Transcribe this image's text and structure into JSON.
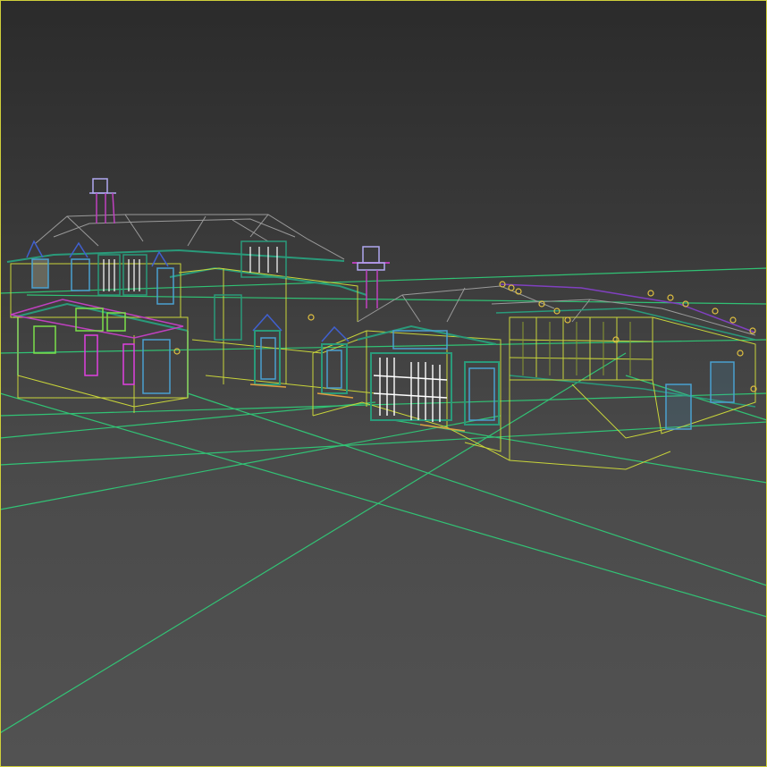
{
  "viewport": {
    "name": "3d-wireframe-viewport",
    "render_mode": "wireframe",
    "colors": {
      "background_top": "#2b2b2b",
      "background_bottom": "#525252",
      "ground_grid": "#2fd07a",
      "active_border": "#cfcf3a"
    }
  },
  "scene": {
    "objects": [
      {
        "name": "main-house-wireframe",
        "palette": [
          "#c8d43a",
          "#2a9a7a",
          "#e0e0e0",
          "#4aa0d0",
          "#c040c0"
        ]
      },
      {
        "name": "central-wing-wireframe",
        "palette": [
          "#c8d43a",
          "#2a9a7a",
          "#ffffff",
          "#4aa0d0"
        ]
      },
      {
        "name": "east-wing-wireframe",
        "palette": [
          "#c8d43a",
          "#8a9a30",
          "#4aa0d0",
          "#8040c0"
        ]
      },
      {
        "name": "chimney-west",
        "palette": [
          "#b0a8f0"
        ]
      },
      {
        "name": "chimney-central",
        "palette": [
          "#b0a8f0",
          "#e040e0"
        ]
      },
      {
        "name": "ground-grid",
        "palette": [
          "#2fd07a"
        ]
      }
    ]
  }
}
